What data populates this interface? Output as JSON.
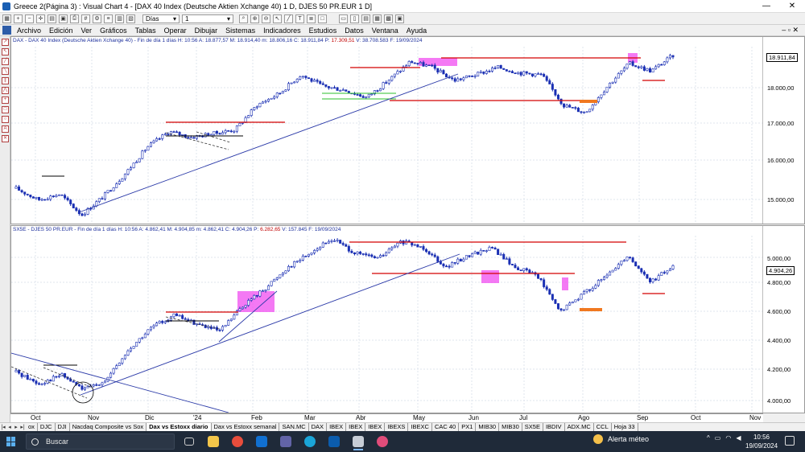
{
  "window": {
    "title": "Greece 2(Página 3) : Visual Chart 4 - [DAX 40 Index (Deutsche Aktien Xchange 40) 1 D, DJES 50 PR.EUR 1 D]",
    "minimize": "—",
    "close": "✕"
  },
  "toolbar": {
    "period": "Días",
    "count": "1"
  },
  "menu": [
    "Archivo",
    "Edición",
    "Ver",
    "Gráficos",
    "Tablas",
    "Operar",
    "Dibujar",
    "Sistemas",
    "Indicadores",
    "Estudios",
    "Datos",
    "Ventana",
    "Ayuda"
  ],
  "pane_top": {
    "header_blue": "DAX - DAX 40 Index (Deutsche Aktien Xchange 40) - Fin de día 1 días  H: 10:56  A: 18.877,57  M: 18.914,40  m: 18.806,16  C: 18.911,84  P: ",
    "header_red": "17.309,51",
    "header_tail": "  V: 38.708.583  F: 19/09/2024",
    "y_ticks": [
      "18.000,00",
      "17.000,00",
      "16.000,00",
      "15.000,00"
    ],
    "last_value": "18.911,84"
  },
  "pane_bottom": {
    "header_blue": "SX5E - DJES 50 PR.EUR - Fin de día 1 días  H: 10:56  A: 4.862,41  M: 4.904,85  m: 4.862,41  C: 4.904,26  P: ",
    "header_red": "6.282,65",
    "header_tail": "  V: 157.845  F: 19/09/2024",
    "y_ticks": [
      "5.000,00",
      "4.800,00",
      "4.600,00",
      "4.400,00",
      "4.200,00",
      "4.000,00"
    ],
    "last_value": "4.904,26"
  },
  "x_axis": [
    "Oct",
    "Nov",
    "Dic",
    "'24",
    "Feb",
    "Mar",
    "Abr",
    "May",
    "Jun",
    "Jul",
    "Ago",
    "Sep",
    "Oct",
    "Nov"
  ],
  "sheet_tabs": [
    {
      "label": "ox",
      "active": false
    },
    {
      "label": "DJC",
      "active": false
    },
    {
      "label": "DJI",
      "active": false
    },
    {
      "label": "Nacdaq Composite vs Sox",
      "active": false
    },
    {
      "label": "Dax vs Estoxx diario",
      "active": true
    },
    {
      "label": "Dax vs Estoxx semanal",
      "active": false
    },
    {
      "label": "SAN.MC",
      "active": false
    },
    {
      "label": "DAX",
      "active": false
    },
    {
      "label": "IBEX",
      "active": false
    },
    {
      "label": "IBEX",
      "active": false
    },
    {
      "label": "IBEX",
      "active": false
    },
    {
      "label": "IBEXS",
      "active": false
    },
    {
      "label": "IBEXC",
      "active": false
    },
    {
      "label": "CAC 40",
      "active": false
    },
    {
      "label": "PX1",
      "active": false
    },
    {
      "label": "MIB30",
      "active": false
    },
    {
      "label": "MIB30",
      "active": false
    },
    {
      "label": "SX5E",
      "active": false
    },
    {
      "label": "IBDIV",
      "active": false
    },
    {
      "label": "ADX.MC",
      "active": false
    },
    {
      "label": "CCL",
      "active": false
    },
    {
      "label": "Hoja 33",
      "active": false
    }
  ],
  "taskbar": {
    "search_placeholder": "Buscar",
    "weather": "Alerta méteo",
    "time": "10:56",
    "date": "19/09/2024"
  },
  "colors": {
    "candle": "#1a2fb3",
    "resistance": "#d40000",
    "support_green": "#2bbf2b",
    "highlight": "#f04cf0",
    "trend": "#2b3aa8",
    "orange": "#f07820"
  },
  "chart_data": [
    {
      "type": "line",
      "series": [
        {
          "name": "DAX",
          "values": [
            15400,
            15100,
            15250,
            14700,
            15200,
            15800,
            16500,
            16900,
            16750,
            16850,
            16950,
            17600,
            17900,
            18400,
            18100,
            18000,
            17800,
            18250,
            18750,
            18600,
            18250,
            18400,
            18600,
            18450,
            18400,
            17600,
            17400,
            18100,
            18700,
            18500,
            18911
          ]
        }
      ],
      "ylim": [
        14600,
        19100
      ]
    },
    {
      "type": "line",
      "series": [
        {
          "name": "SX5E",
          "values": [
            4200,
            4120,
            4180,
            4080,
            4150,
            4350,
            4500,
            4580,
            4520,
            4470,
            4640,
            4760,
            4900,
            5000,
            5090,
            4990,
            4960,
            5070,
            5030,
            4900,
            4980,
            5030,
            4900,
            4850,
            4600,
            4720,
            4830,
            4980,
            4800,
            4904
          ]
        }
      ],
      "ylim": [
        3960,
        5100
      ]
    }
  ]
}
